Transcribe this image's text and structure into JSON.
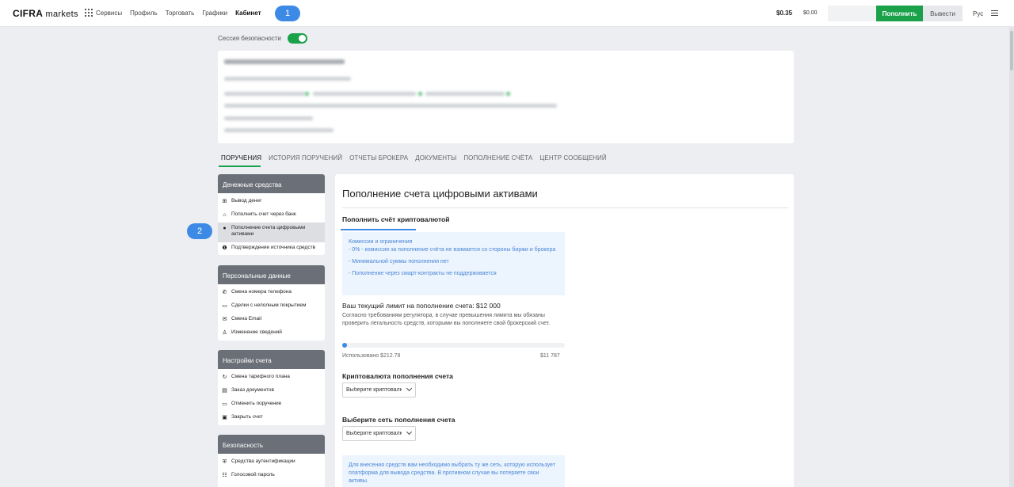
{
  "header": {
    "logo_bold": "CIFRA",
    "logo_light": " markets",
    "nav": [
      {
        "label": "Сервисы"
      },
      {
        "label": "Профиль"
      },
      {
        "label": "Торговать"
      },
      {
        "label": "Графики"
      },
      {
        "label": "Кабинет"
      }
    ],
    "balance_usd": "$0.35",
    "balance_other": "$0.00",
    "deposit_label": "Пополнить",
    "withdraw_label": "Вывести",
    "language": "Рус"
  },
  "annotations": {
    "marker1": "1",
    "marker2": "2"
  },
  "session": {
    "label": "Сессия безопасности",
    "enabled": true
  },
  "tabs": [
    {
      "label": "ПОРУЧЕНИЯ",
      "active": true
    },
    {
      "label": "ИСТОРИЯ ПОРУЧЕНИЙ"
    },
    {
      "label": "ОТЧЕТЫ БРОКЕРА"
    },
    {
      "label": "ДОКУМЕНТЫ"
    },
    {
      "label": "ПОПОЛНЕНИЕ СЧЁТА"
    },
    {
      "label": "ЦЕНТР СООБЩЕНИЙ"
    }
  ],
  "sidebar": {
    "groups": [
      {
        "title": "Денежные средства",
        "items": [
          {
            "label": "Вывод денег",
            "icon": "withdraw-icon"
          },
          {
            "label": "Пополнить счет через банк",
            "icon": "bank-icon"
          },
          {
            "label": "Пополнение счета цифровыми активами",
            "icon": "crypto-icon",
            "selected": true
          },
          {
            "label": "Подтверждение источника средств",
            "icon": "info-icon"
          }
        ]
      },
      {
        "title": "Персональные данные",
        "items": [
          {
            "label": "Смена номера телефона",
            "icon": "phone-icon"
          },
          {
            "label": "Сделки с неполным покрытием",
            "icon": "monitor-icon"
          },
          {
            "label": "Смена Email",
            "icon": "mail-icon"
          },
          {
            "label": "Изменение сведений",
            "icon": "user-edit-icon"
          }
        ]
      },
      {
        "title": "Настройки счета",
        "items": [
          {
            "label": "Смена тарифного плана",
            "icon": "refresh-icon"
          },
          {
            "label": "Заказ документов",
            "icon": "document-icon"
          },
          {
            "label": "Отменить поручение",
            "icon": "monitor-icon"
          },
          {
            "label": "Закрыть счет",
            "icon": "close-account-icon"
          }
        ]
      },
      {
        "title": "Безопасность",
        "items": [
          {
            "label": "Средства аутентификации",
            "icon": "shield-icon"
          },
          {
            "label": "Голосовой пароль",
            "icon": "voice-icon"
          }
        ]
      }
    ]
  },
  "main": {
    "title": "Пополнение счета цифровыми активами",
    "subtab": "Пополнить счёт криптовалютой",
    "info_lines": [
      "Комиссии и ограничения",
      "- 0% - комиссия за пополнение счёта не взимается со стороны биржи и брокера",
      "- Минимальной суммы пополнения нет",
      "- Пополнение через смарт-контракты не поддерживается"
    ],
    "limit_title": "Ваш текущий лимит на пополнение счета: $12 000",
    "limit_desc": "Согласно требованиям регулятора, в случае превышения лимита мы обязаны проверить легальность средств, которыми вы пополняете свой брокерский счет.",
    "used_label": "Использовано $212.78",
    "max_label": "$11 787",
    "progress_fraction": 0.018,
    "crypto_label": "Криптовалюта пополнения счета",
    "crypto_placeholder": "Выберите криптовалюту",
    "network_label": "Выберите сеть пополнения счета",
    "network_placeholder": "Выберите криптовалюту",
    "warning": "Для внесения средств вам необходимо выбрать ту же сеть, которую использует платформа для вывода средства. В противном случае вы потеряете свои активы."
  },
  "colors": {
    "accent_green": "#1aa14a",
    "accent_blue": "#3d8ae6",
    "menu_header": "#6b6f78"
  }
}
